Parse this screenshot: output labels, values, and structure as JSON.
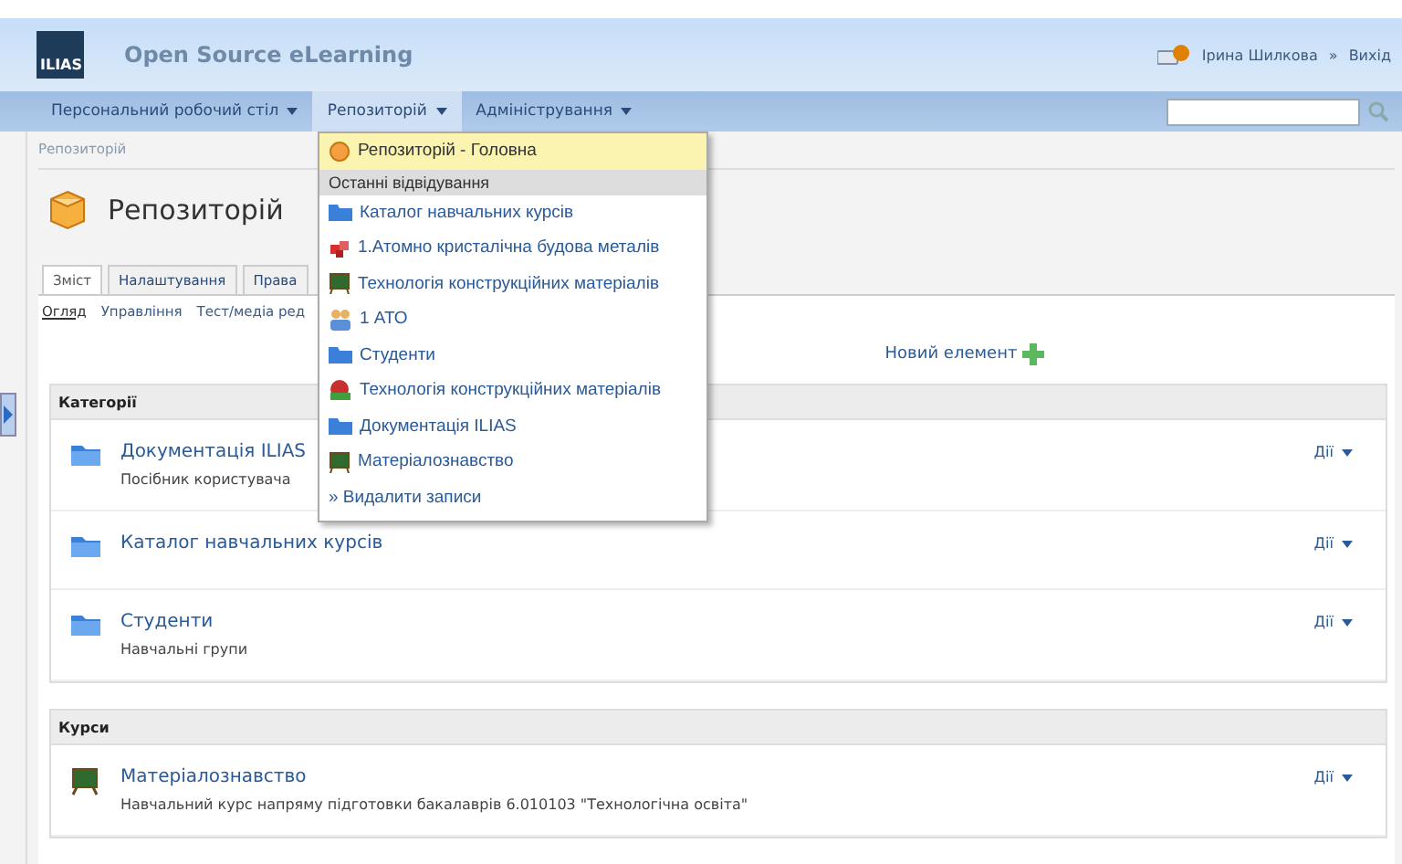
{
  "header": {
    "logo": "ILIAS",
    "title": "Open Source eLearning",
    "user": "Ірина Шилкова",
    "separator": "»",
    "logout": "Вихід"
  },
  "nav": [
    {
      "label": "Персональний робочий стіл",
      "selected": false
    },
    {
      "label": "Репозиторій",
      "selected": true
    },
    {
      "label": "Адміністрування",
      "selected": false
    }
  ],
  "dropdown": [
    {
      "kind": "repository",
      "label": "Репозиторій - Головна",
      "selected": true
    },
    {
      "kind": "header",
      "label": "Останні відвідування"
    },
    {
      "kind": "category",
      "label": "Каталог навчальних курсів",
      "selected": false
    },
    {
      "kind": "learning-module",
      "label": "1.Атомно кристалічна будова металів",
      "selected": false
    },
    {
      "kind": "course",
      "label": "Технологія конструкційних матеріалів",
      "selected": false
    },
    {
      "kind": "group",
      "label": "1 АТО",
      "selected": false
    },
    {
      "kind": "category",
      "label": "Студенти",
      "selected": false
    },
    {
      "kind": "glossary",
      "label": "Технологія конструкційних матеріалів",
      "selected": false
    },
    {
      "kind": "category",
      "label": "Документація ILIAS",
      "selected": false
    },
    {
      "kind": "course",
      "label": "Матеріалознавство",
      "selected": false
    },
    {
      "kind": "link",
      "label": "» Видалити записи"
    }
  ],
  "breadcrumb": "Репозиторій",
  "page_title": "Репозиторій",
  "tabs": [
    {
      "label": "Зміст",
      "selected": true
    },
    {
      "label": "Налаштування",
      "selected": false
    },
    {
      "label": "Права",
      "selected": false
    }
  ],
  "subtabs": [
    {
      "label": "Огляд",
      "selected": true
    },
    {
      "label": "Управління",
      "selected": false
    },
    {
      "label": "Тест/медіа ред",
      "selected": false
    }
  ],
  "new_item": "Новий елемент",
  "sections": [
    {
      "title": "Категорії",
      "items": [
        {
          "kind": "category",
          "title": "Документація ILIAS",
          "description": "Посібник користувача",
          "actions": "Дії"
        },
        {
          "kind": "category",
          "title": "Каталог навчальних курсів",
          "actions": "Дії"
        },
        {
          "kind": "category",
          "title": "Студенти",
          "description": "Навчальні групи",
          "actions": "Дії"
        }
      ]
    },
    {
      "title": "Курси",
      "items": [
        {
          "kind": "course",
          "title": "Матеріалознавство",
          "description": "Навчальний курс напряму підготовки бакалаврів 6.010103 \"Технологічна освіта\"",
          "actions": "Дії"
        }
      ]
    }
  ]
}
